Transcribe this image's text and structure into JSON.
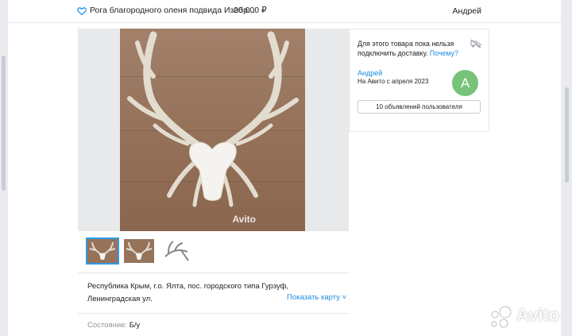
{
  "header": {
    "title": "Рога благородного оленя подвида Изобр...",
    "price": "20 000 ₽",
    "user": "Андрей"
  },
  "gallery": {
    "watermark": "Avito",
    "thumbnails": [
      "photo-1",
      "photo-2",
      "photo-3"
    ]
  },
  "location": {
    "address": "Республика Крым, г.о. Ялта, пос. городского типа Гурзуф, Ленинградская ул.",
    "map_link": "Показать карту"
  },
  "details": {
    "condition_label": "Состояние:",
    "condition_value": "Б/у"
  },
  "sidebar": {
    "delivery_text": "Для этого товара пока нельзя подключить доставку.",
    "delivery_link": "Почему?",
    "seller_name": "Андрей",
    "seller_since": "На Авито с апреля 2023",
    "avatar_letter": "А",
    "ads_button": "10 объявлений пользователя"
  },
  "page_watermark": "Avito",
  "colors": {
    "link": "#1a8de0",
    "avatar": "#77c37a",
    "selected_thumb": "#2d9be6"
  }
}
